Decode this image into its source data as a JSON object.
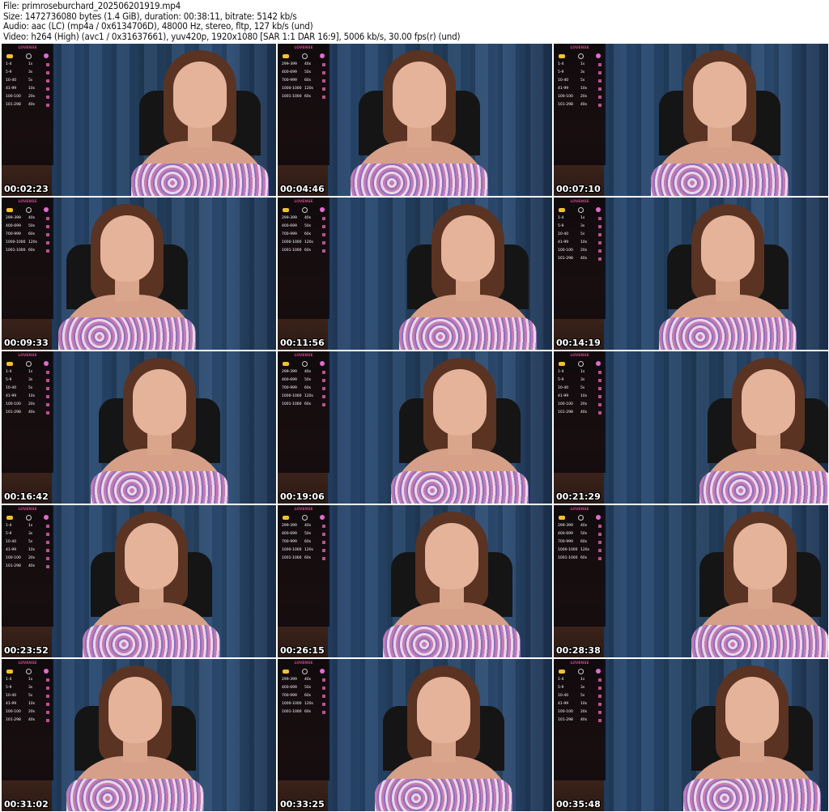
{
  "header": {
    "file": "File: primroseburchard_202506201919.mp4",
    "size": "Size: 1472736080 bytes (1.4 GiB), duration: 00:38:11, bitrate: 5142 kb/s",
    "audio": "Audio: aac (LC) (mp4a / 0x6134706D), 48000 Hz, stereo, fltp, 127 kb/s (und)",
    "video": "Video: h264 (High) (avc1 / 0x31637661), yuv420p, 1920x1080 [SAR 1:1 DAR 16:9], 5006 kb/s, 30.00 fps(r) (und)"
  },
  "overlay": {
    "brand": "LOVENSE",
    "tables": [
      [
        [
          "1-4",
          "1s"
        ],
        [
          "5-9",
          "3s"
        ],
        [
          "10-40",
          "5s"
        ],
        [
          "41-99",
          "10s"
        ],
        [
          "100-100",
          "20s"
        ],
        [
          "101-298",
          "40s"
        ]
      ],
      [
        [
          "299-399",
          "40s"
        ],
        [
          "400-699",
          "50s"
        ],
        [
          "700-999",
          "60s"
        ],
        [
          "1000-1000",
          "120s"
        ],
        [
          "1001-1000",
          "60s"
        ]
      ]
    ]
  },
  "thumbnails": [
    {
      "time": "00:02:23",
      "table": 0
    },
    {
      "time": "00:04:46",
      "table": 1
    },
    {
      "time": "00:07:10",
      "table": 0
    },
    {
      "time": "00:09:33",
      "table": 1
    },
    {
      "time": "00:11:56",
      "table": 1
    },
    {
      "time": "00:14:19",
      "table": 0
    },
    {
      "time": "00:16:42",
      "table": 0
    },
    {
      "time": "00:19:06",
      "table": 1
    },
    {
      "time": "00:21:29",
      "table": 0
    },
    {
      "time": "00:23:52",
      "table": 0
    },
    {
      "time": "00:26:15",
      "table": 1
    },
    {
      "time": "00:28:38",
      "table": 1
    },
    {
      "time": "00:31:02",
      "table": 0
    },
    {
      "time": "00:33:25",
      "table": 1
    },
    {
      "time": "00:35:48",
      "table": 0
    }
  ]
}
